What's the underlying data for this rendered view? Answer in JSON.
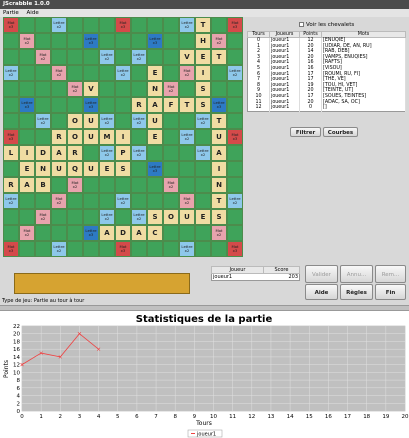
{
  "window": {
    "title": "JScrabble 1.0.0"
  },
  "menu": {
    "items": [
      "Partie",
      "Aide"
    ]
  },
  "board": {
    "size": 15,
    "premiums": [
      "M3..L2...M3...L2..M3",
      ""
    ],
    "labels": {
      "M3": "Mot\nx3",
      "M2": "Mot\nx2",
      "L3": "Lettre\nx3",
      "L2": "Lettre\nx2"
    }
  },
  "premium_rows": [
    [
      "M3",
      "",
      "",
      "L2",
      "",
      "",
      "",
      "M3",
      "",
      "",
      "",
      "L2",
      "",
      "",
      "M3"
    ],
    [
      "",
      "M2",
      "",
      "",
      "",
      "L3",
      "",
      "",
      "",
      "L3",
      "",
      "",
      "",
      "M2",
      ""
    ],
    [
      "",
      "",
      "M2",
      "",
      "",
      "",
      "L2",
      "",
      "L2",
      "",
      "",
      "",
      "M2",
      "",
      ""
    ],
    [
      "L2",
      "",
      "",
      "M2",
      "",
      "",
      "",
      "L2",
      "",
      "",
      "",
      "M2",
      "",
      "",
      "L2"
    ],
    [
      "",
      "",
      "",
      "",
      "M2",
      "",
      "",
      "",
      "",
      "",
      "M2",
      "",
      "",
      "",
      ""
    ],
    [
      "",
      "L3",
      "",
      "",
      "",
      "L3",
      "",
      "",
      "",
      "L3",
      "",
      "",
      "",
      "L3",
      ""
    ],
    [
      "",
      "",
      "L2",
      "",
      "",
      "",
      "L2",
      "",
      "L2",
      "",
      "",
      "",
      "L2",
      "",
      ""
    ],
    [
      "M3",
      "",
      "",
      "L2",
      "",
      "",
      "",
      "M2",
      "",
      "",
      "",
      "L2",
      "",
      "",
      "M3"
    ],
    [
      "",
      "",
      "L2",
      "",
      "",
      "",
      "L2",
      "",
      "L2",
      "",
      "",
      "",
      "L2",
      "",
      ""
    ],
    [
      "",
      "L3",
      "",
      "",
      "",
      "L3",
      "",
      "",
      "",
      "L3",
      "",
      "",
      "",
      "L3",
      ""
    ],
    [
      "",
      "",
      "",
      "",
      "M2",
      "",
      "",
      "",
      "",
      "",
      "M2",
      "",
      "",
      "",
      ""
    ],
    [
      "L2",
      "",
      "",
      "M2",
      "",
      "",
      "",
      "L2",
      "",
      "",
      "",
      "M2",
      "",
      "",
      "L2"
    ],
    [
      "",
      "",
      "M2",
      "",
      "",
      "",
      "L2",
      "",
      "L2",
      "",
      "",
      "",
      "M2",
      "",
      ""
    ],
    [
      "",
      "M2",
      "",
      "",
      "",
      "L3",
      "",
      "",
      "",
      "L3",
      "",
      "",
      "",
      "M2",
      ""
    ],
    [
      "M3",
      "",
      "",
      "L2",
      "",
      "",
      "",
      "M3",
      "",
      "",
      "",
      "L2",
      "",
      "",
      "M3"
    ]
  ],
  "tiles": [
    [
      0,
      12,
      "T"
    ],
    [
      1,
      12,
      "H"
    ],
    [
      2,
      11,
      "V"
    ],
    [
      2,
      12,
      "E"
    ],
    [
      2,
      13,
      "T"
    ],
    [
      3,
      9,
      "E"
    ],
    [
      3,
      12,
      "I"
    ],
    [
      4,
      5,
      "V"
    ],
    [
      4,
      9,
      "N"
    ],
    [
      4,
      12,
      "S"
    ],
    [
      5,
      8,
      "R"
    ],
    [
      5,
      9,
      "A"
    ],
    [
      5,
      10,
      "F"
    ],
    [
      5,
      11,
      "T"
    ],
    [
      5,
      12,
      "S"
    ],
    [
      6,
      4,
      "O"
    ],
    [
      6,
      5,
      "U"
    ],
    [
      6,
      9,
      "U"
    ],
    [
      6,
      13,
      "T"
    ],
    [
      7,
      3,
      "R"
    ],
    [
      7,
      4,
      "O"
    ],
    [
      7,
      5,
      "U"
    ],
    [
      7,
      6,
      "M"
    ],
    [
      7,
      7,
      "I"
    ],
    [
      7,
      9,
      "E"
    ],
    [
      7,
      13,
      "U"
    ],
    [
      8,
      0,
      "L"
    ],
    [
      8,
      1,
      "I"
    ],
    [
      8,
      2,
      "D"
    ],
    [
      8,
      3,
      "A"
    ],
    [
      8,
      4,
      "R"
    ],
    [
      8,
      7,
      "P"
    ],
    [
      8,
      13,
      "A"
    ],
    [
      9,
      1,
      "E"
    ],
    [
      9,
      2,
      "N"
    ],
    [
      9,
      3,
      "U"
    ],
    [
      9,
      4,
      "Q"
    ],
    [
      9,
      5,
      "U"
    ],
    [
      9,
      6,
      "E"
    ],
    [
      9,
      7,
      "S"
    ],
    [
      9,
      13,
      "I"
    ],
    [
      10,
      0,
      "R"
    ],
    [
      10,
      1,
      "A"
    ],
    [
      10,
      2,
      "B"
    ],
    [
      10,
      13,
      "N"
    ],
    [
      11,
      13,
      "T"
    ],
    [
      12,
      9,
      "S"
    ],
    [
      12,
      10,
      "O"
    ],
    [
      12,
      11,
      "U"
    ],
    [
      12,
      12,
      "E"
    ],
    [
      12,
      13,
      "S"
    ],
    [
      13,
      6,
      "A"
    ],
    [
      13,
      7,
      "D"
    ],
    [
      13,
      8,
      "A"
    ],
    [
      13,
      9,
      "C"
    ]
  ],
  "chevalets": {
    "label": "Voir les chevalets"
  },
  "moves_table": {
    "headers": [
      "Tours",
      "Joueurs",
      "Points",
      "Mots"
    ],
    "rows": [
      [
        "0",
        "joueur1",
        "12",
        "[ENUQIE]"
      ],
      [
        "1",
        "joueur1",
        "20",
        "[UDIAR, DE, AN, RU]"
      ],
      [
        "2",
        "joueur1",
        "14",
        "[RAB, DEB]"
      ],
      [
        "3",
        "joueur1",
        "20",
        "[VAMPS, ENUQIES]"
      ],
      [
        "4",
        "joueur1",
        "16",
        "[RAFTS]"
      ],
      [
        "5",
        "joueur1",
        "16",
        "[VISOU]"
      ],
      [
        "6",
        "joueur1",
        "17",
        "[ROUMI, RU, FI]"
      ],
      [
        "7",
        "joueur1",
        "17",
        "[THE, VE]"
      ],
      [
        "8",
        "joueur1",
        "19",
        "[TOU, HI, VET]"
      ],
      [
        "9",
        "joueur1",
        "20",
        "[TEINTE, UT]"
      ],
      [
        "10",
        "joueur1",
        "17",
        "[SOUES, TEINTES]"
      ],
      [
        "11",
        "joueur1",
        "20",
        "[ADAC, SA, OC]"
      ],
      [
        "12",
        "joueur1",
        "0",
        "[]"
      ]
    ]
  },
  "buttons": {
    "filtrer": "Filtrer",
    "courbes": "Courbes",
    "valider": "Valider",
    "annuler": "Annu...",
    "remplacer": "Rem...",
    "aide": "Aide",
    "regles": "Règles",
    "fin": "Fin"
  },
  "scores_table": {
    "headers": [
      "Joueur",
      "Score"
    ],
    "rows": [
      [
        "joueur1",
        "203"
      ]
    ]
  },
  "status": "Type de jeu: Partie au tour à tour",
  "colors": {
    "board_green": "#3fa35a",
    "tile": "#f0dca3",
    "word_x3": "#d44a4a",
    "word_x2": "#e8a3ad",
    "letter_x3": "#2d7ac4",
    "letter_x2": "#8ec8ea",
    "rack": "#d6a331",
    "series": "#ee4444"
  },
  "chart_data": {
    "type": "line",
    "title": "Statistiques de la partie",
    "xlabel": "Tours",
    "ylabel": "Points",
    "xlim": [
      0,
      20
    ],
    "ylim": [
      0,
      22
    ],
    "x_ticks": [
      0,
      1,
      2,
      3,
      4,
      5,
      6,
      7,
      8,
      9,
      10,
      11,
      12,
      13,
      14,
      15,
      16,
      17,
      18,
      19,
      20
    ],
    "y_ticks": [
      0,
      2,
      4,
      6,
      8,
      10,
      12,
      14,
      16,
      18,
      20,
      22
    ],
    "grid": true,
    "legend": "bottom",
    "series": [
      {
        "name": "joueur1",
        "x": [
          0,
          1,
          2,
          3,
          4
        ],
        "y": [
          12,
          15,
          14,
          20,
          16
        ]
      }
    ]
  }
}
